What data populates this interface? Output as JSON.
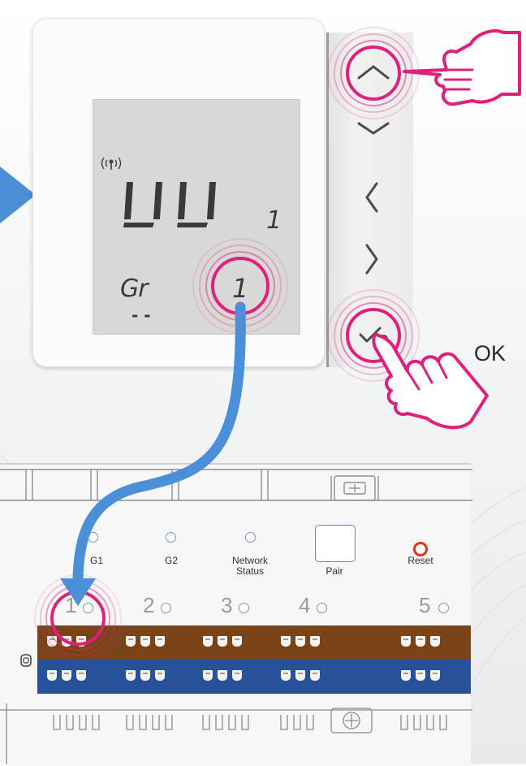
{
  "thermostat": {
    "segment_main": "UU",
    "segment_small": "1",
    "param_label": "Gr",
    "param_value": "1",
    "param_dashes": "- -",
    "buttons": [
      "up",
      "down",
      "left",
      "right",
      "ok"
    ]
  },
  "ok_label": "OK",
  "controller": {
    "g1_label": "G1",
    "g2_label": "G2",
    "network_label_line1": "Network",
    "network_label_line2": "Status",
    "pair_label": "Pair",
    "reset_label": "Reset",
    "zone_numbers": [
      "1",
      "2",
      "3",
      "4",
      "5"
    ]
  },
  "colors": {
    "highlight_pink": "#e0207a",
    "arrow_blue": "#4a8fd8",
    "band_brown": "#7a4418",
    "band_blue": "#27529a",
    "reset_red": "#e0331c"
  }
}
